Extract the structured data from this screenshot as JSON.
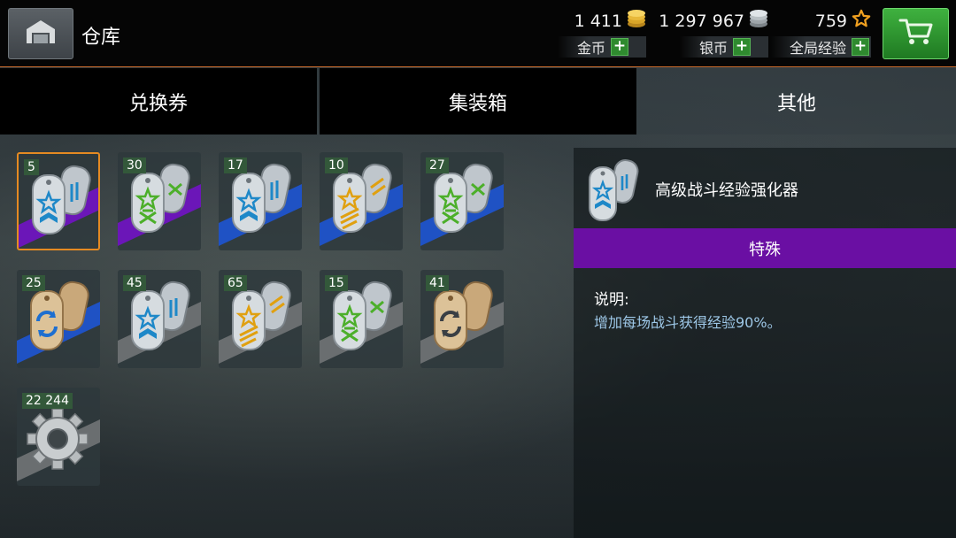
{
  "header": {
    "title": "仓库",
    "currencies": {
      "gold": {
        "amount": "1 411",
        "label": "金币",
        "icon": "gold-coins-icon"
      },
      "silver": {
        "amount": "1 297 967",
        "label": "银币",
        "icon": "silver-coins-icon"
      },
      "xp": {
        "amount": "759",
        "label": "全局经验",
        "icon": "star-icon"
      }
    },
    "plus": "+"
  },
  "tabs": [
    {
      "label": "兑换券",
      "active": false
    },
    {
      "label": "集装箱",
      "active": false
    },
    {
      "label": "其他",
      "active": true
    }
  ],
  "items": [
    {
      "count": "5",
      "icon": "blue-star-dogtag-icon",
      "ribbon": "purple",
      "selected": true
    },
    {
      "count": "30",
      "icon": "green-crew-dogtag-icon",
      "ribbon": "purple"
    },
    {
      "count": "17",
      "icon": "blue-star-dogtag-icon",
      "ribbon": "blue"
    },
    {
      "count": "10",
      "icon": "gold-star-dogtag-icon",
      "ribbon": "blue"
    },
    {
      "count": "27",
      "icon": "green-crew-dogtag-icon",
      "ribbon": "blue"
    },
    {
      "count": "25",
      "icon": "bronze-refresh-dogtag-icon",
      "ribbon": "blue"
    },
    {
      "count": "45",
      "icon": "blue-star-dogtag-icon",
      "ribbon": "gray"
    },
    {
      "count": "65",
      "icon": "gold-star-dogtag-icon",
      "ribbon": "gray"
    },
    {
      "count": "15",
      "icon": "green-crew-dogtag-icon",
      "ribbon": "gray"
    },
    {
      "count": "41",
      "icon": "bronze-refresh-dogtag-icon",
      "ribbon": "gray"
    },
    {
      "count": "22 244",
      "icon": "gear-part-icon",
      "ribbon": "gray"
    }
  ],
  "detail": {
    "title": "高级战斗经验强化器",
    "rarity": "特殊",
    "desc_label": "说明:",
    "desc_text": "增加每场战斗获得经验90%。"
  },
  "colors": {
    "accent_orange": "#e58a22",
    "rarity_purple": "#6a0fa3",
    "ribbon_purple": "#6b16b8",
    "ribbon_blue": "#1f52c4",
    "ribbon_gray": "#6a6e70",
    "buy_green": "#2f9a30"
  }
}
